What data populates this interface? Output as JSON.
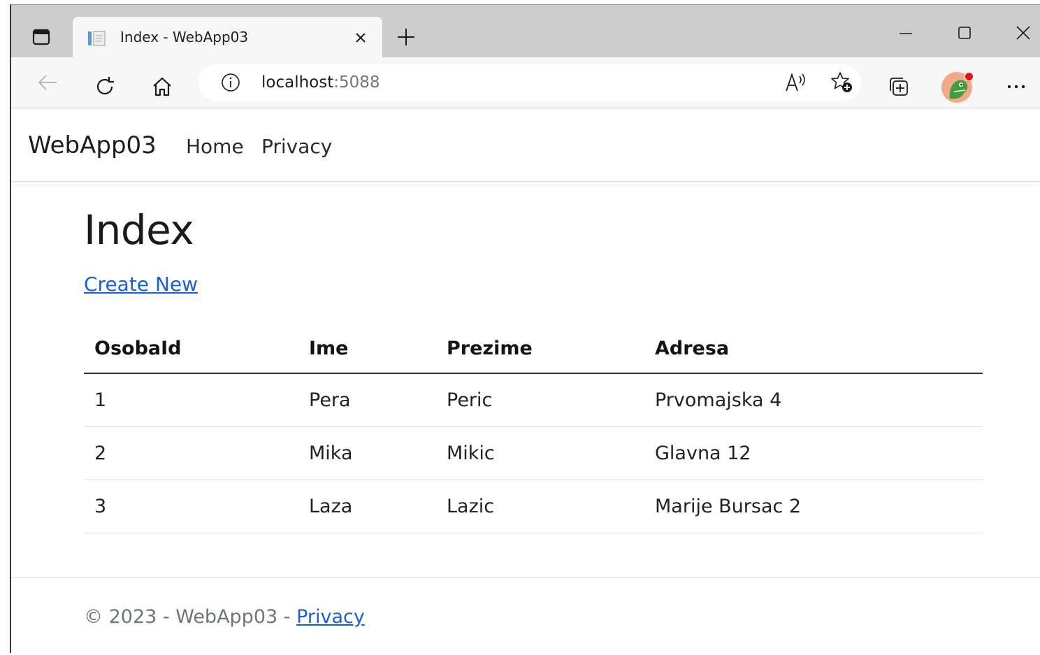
{
  "browser": {
    "tab": {
      "title": "Index - WebApp03"
    },
    "address": {
      "host": "localhost",
      "port": ":5088"
    },
    "icons": {
      "tab_actions": "tab-actions-icon",
      "favicon": "page-icon",
      "tab_close": "close-icon",
      "new_tab": "plus-icon",
      "minimize": "minimize-icon",
      "maximize": "maximize-icon",
      "close": "close-icon",
      "back": "arrow-left-icon",
      "refresh": "refresh-icon",
      "home": "home-icon",
      "site_info": "info-icon",
      "read_aloud": "read-aloud-icon",
      "favorites": "star-add-icon",
      "collections": "collections-icon",
      "profile": "avatar",
      "more": "ellipsis-icon"
    },
    "colors": {
      "avatar_badge": "#e81123",
      "link": "#1a5fd6"
    }
  },
  "navbar": {
    "brand": "WebApp03",
    "links": [
      "Home",
      "Privacy"
    ]
  },
  "main": {
    "title": "Index",
    "create_link": "Create New",
    "table": {
      "headers": [
        "OsobaId",
        "Ime",
        "Prezime",
        "Adresa"
      ],
      "rows": [
        [
          "1",
          "Pera",
          "Peric",
          "Prvomajska 4"
        ],
        [
          "2",
          "Mika",
          "Mikic",
          "Glavna 12"
        ],
        [
          "3",
          "Laza",
          "Lazic",
          "Marije Bursac 2"
        ]
      ]
    }
  },
  "footer": {
    "text": "© 2023 - WebApp03 - ",
    "link": "Privacy"
  }
}
